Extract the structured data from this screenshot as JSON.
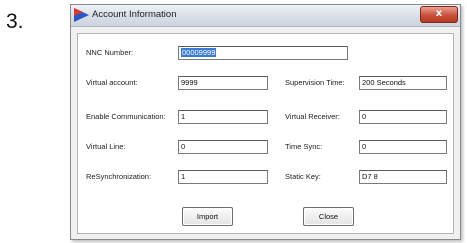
{
  "step_number": "3.",
  "window": {
    "title": "Account Information",
    "close_label": "x"
  },
  "fields": {
    "nnc_number": {
      "label": "NNC Number:",
      "value": "00009999"
    },
    "virtual_account": {
      "label": "Virtual account:",
      "value": "9999"
    },
    "supervision_time": {
      "label": "Supervision Time:",
      "value": "200 Seconds"
    },
    "enable_communication": {
      "label": "Enable Communication:",
      "value": "1"
    },
    "virtual_receiver": {
      "label": "Virtual Receiver:",
      "value": "0"
    },
    "virtual_line": {
      "label": "Virtual Line:",
      "value": "0"
    },
    "time_sync": {
      "label": "Time Sync:",
      "value": "0"
    },
    "resynchronization": {
      "label": "ReSynchronization:",
      "value": "1"
    },
    "static_key": {
      "label": "Static Key:",
      "value": "D7 8"
    }
  },
  "buttons": {
    "import": "Import",
    "close": "Close"
  }
}
